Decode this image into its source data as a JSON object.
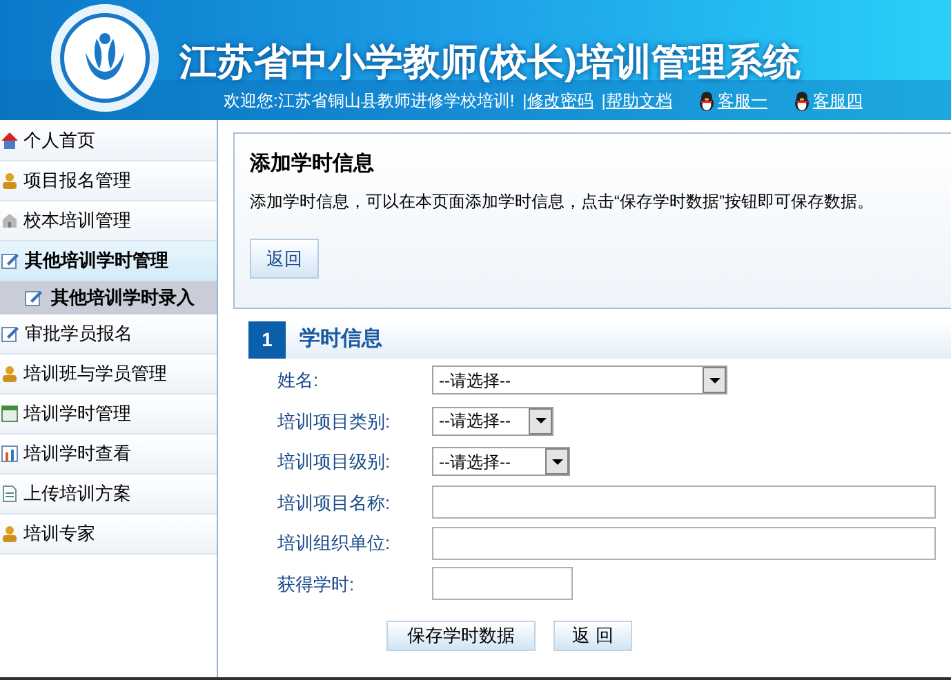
{
  "header": {
    "title": "江苏省中小学教师(校长)培训管理系统",
    "welcome": "欢迎您:江苏省铜山县教师进修学校培训!",
    "links": [
      "|修改密码",
      "|帮助文档"
    ],
    "service_links": [
      "客服一",
      "客服四"
    ]
  },
  "sidebar": {
    "items": [
      {
        "label": "个人首页",
        "selected": false
      },
      {
        "label": "项目报名管理",
        "selected": false
      },
      {
        "label": "校本培训管理",
        "selected": false
      },
      {
        "label": "其他培训学时管理",
        "selected": false,
        "expanded": true,
        "children": [
          {
            "label": "其他培训学时录入",
            "selected": true
          }
        ]
      },
      {
        "label": "审批学员报名",
        "selected": false
      },
      {
        "label": "培训班与学员管理",
        "selected": false
      },
      {
        "label": "培训学时管理",
        "selected": false
      },
      {
        "label": "培训学时查看",
        "selected": false
      },
      {
        "label": "上传培训方案",
        "selected": false
      },
      {
        "label": "培训专家",
        "selected": false
      }
    ]
  },
  "info_panel": {
    "title": "添加学时信息",
    "description": "添加学时信息，可以在本页面添加学时信息，点击“保存学时数据”按钮即可保存数据。",
    "button": "返回"
  },
  "section": {
    "number": "1",
    "title": "学时信息"
  },
  "form": {
    "fields": [
      {
        "label": "姓名:",
        "kind": "select",
        "value": "--请选择--"
      },
      {
        "label": "培训项目类别:",
        "kind": "select",
        "value": "--请选择--"
      },
      {
        "label": "培训项目级别:",
        "kind": "select",
        "value": "--请选择--"
      },
      {
        "label": "培训项目名称:",
        "kind": "text"
      },
      {
        "label": "培训组织单位:",
        "kind": "text"
      },
      {
        "label": "获得学时:",
        "kind": "text"
      }
    ]
  },
  "buttons": [
    "保存学时数据",
    "返 回"
  ]
}
